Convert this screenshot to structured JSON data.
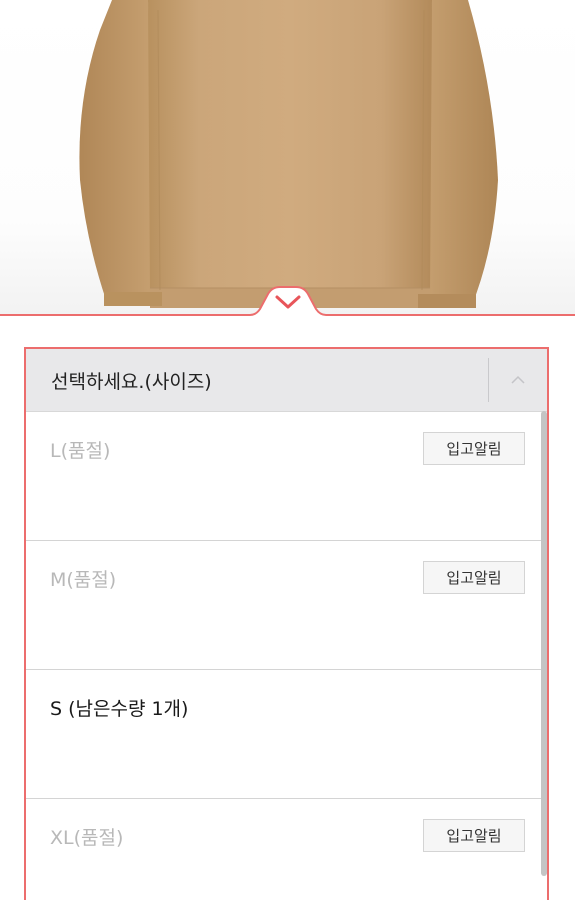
{
  "product": {
    "image_icon": "sweater-photo",
    "sweater_color": "#c8a478"
  },
  "sheet": {
    "toggle_icon": "chevron-down-icon",
    "accent_color": "#ec6d6d"
  },
  "size_select": {
    "placeholder": "선택하세요.(사이즈)",
    "collapse_icon": "chevron-up-icon",
    "options": [
      {
        "label": "L(품절)",
        "status": "soldout",
        "notify_label": "입고알림"
      },
      {
        "label": "M(품절)",
        "status": "soldout",
        "notify_label": "입고알림"
      },
      {
        "label": "S (남은수량 1개)",
        "status": "available"
      },
      {
        "label": "XL(품절)",
        "status": "soldout",
        "notify_label": "입고알림"
      }
    ]
  }
}
